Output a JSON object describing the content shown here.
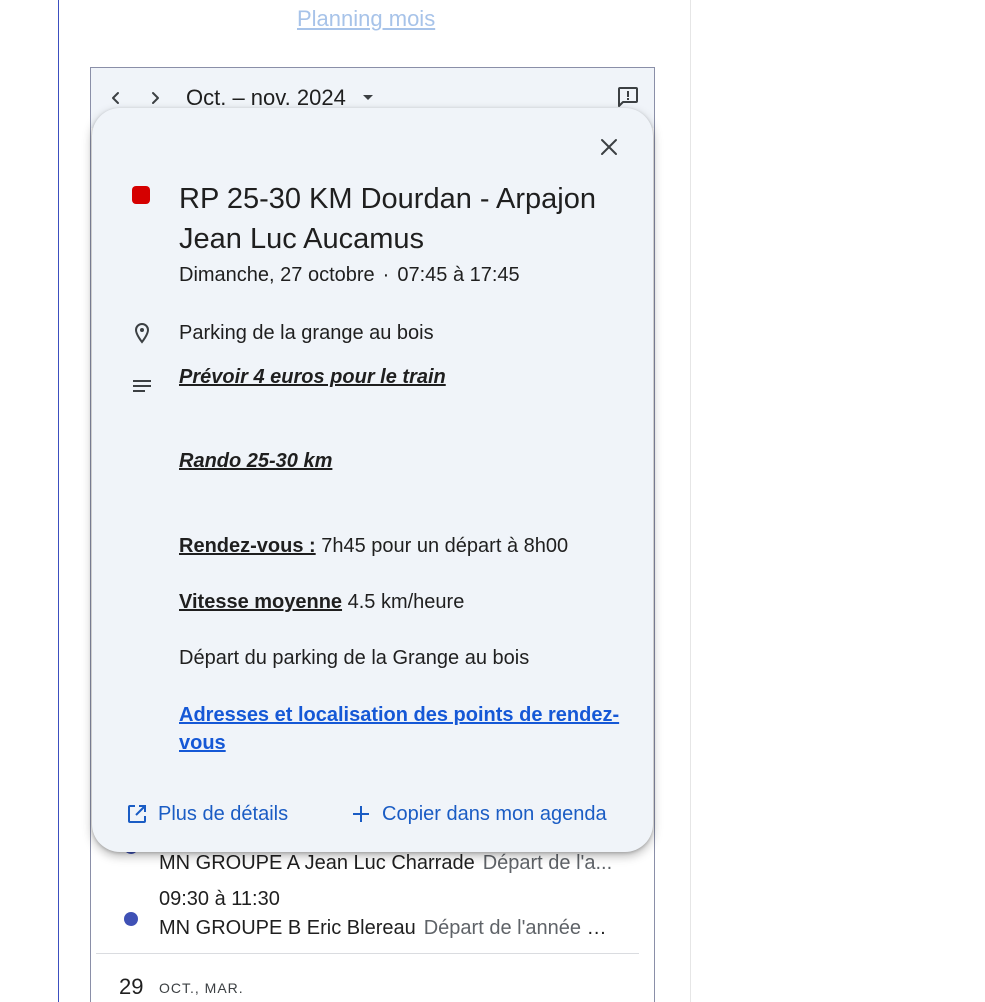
{
  "page": {
    "planning_link": "Planning mois"
  },
  "calendar": {
    "month_label": "Oct. – nov. 2024"
  },
  "popup": {
    "title": "RP 25-30 KM Dourdan - Arpajon Jean Luc Aucamus",
    "date": "Dimanche, 27 octobre",
    "time_separator": "·",
    "time_range": "07:45 à 17:45",
    "location": "Parking de la grange au bois",
    "description": {
      "line1": "Prévoir 4 euros pour le train",
      "line2": "Rando 25-30 km",
      "rdv_label": "Rendez-vous :",
      "rdv_text": " 7h45 pour un départ à 8h00",
      "speed_label": "Vitesse moyenne",
      "speed_text": " 4.5 km/heure",
      "departure": "Départ du parking de la Grange au bois",
      "link": "Adresses et localisation des points de rendez-vous"
    },
    "actions": {
      "details": "Plus de détails",
      "copy": "Copier dans mon agenda"
    },
    "chip_color": "#d50000"
  },
  "events": [
    {
      "title": "MN GROUPE A Jean Luc Charrade",
      "desc": "Départ de l'a..."
    },
    {
      "time": "09:30 à 11:30",
      "title": "MN GROUPE B Eric Blereau",
      "desc": "Départ de l'année d..."
    }
  ],
  "next_day": {
    "number": "29",
    "label": "OCT., MAR."
  },
  "colors": {
    "accent": "#1a5cc4",
    "event_dot": "#3f51b5",
    "popup_bg": "#f0f4f9"
  }
}
